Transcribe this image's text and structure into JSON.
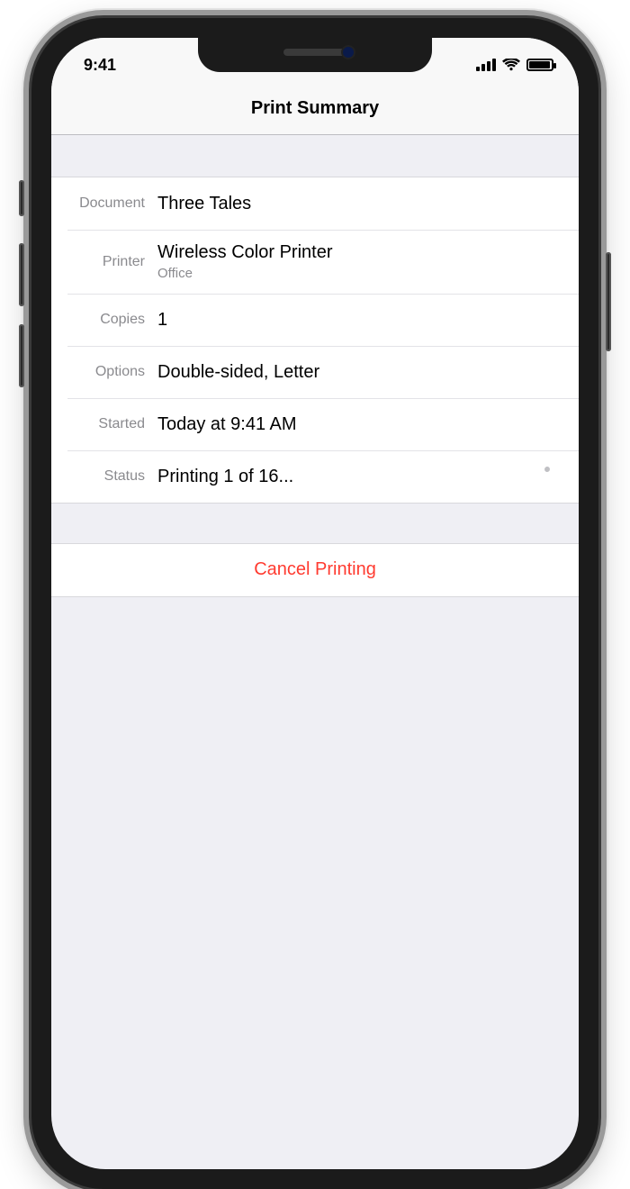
{
  "status_bar": {
    "time": "9:41"
  },
  "header": {
    "title": "Print Summary"
  },
  "details": {
    "document": {
      "label": "Document",
      "value": "Three Tales"
    },
    "printer": {
      "label": "Printer",
      "value": "Wireless Color Printer",
      "sub": "Office"
    },
    "copies": {
      "label": "Copies",
      "value": "1"
    },
    "options": {
      "label": "Options",
      "value": "Double-sided, Letter"
    },
    "started": {
      "label": "Started",
      "value": "Today at 9:41 AM"
    },
    "status": {
      "label": "Status",
      "value": "Printing 1 of 16..."
    }
  },
  "actions": {
    "cancel": "Cancel Printing"
  }
}
